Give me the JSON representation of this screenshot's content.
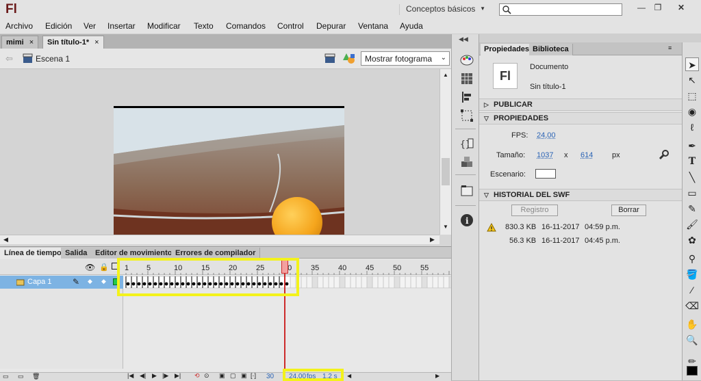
{
  "app": {
    "logo": "Fl"
  },
  "workspace": {
    "label": "Conceptos básicos"
  },
  "menu": [
    "Archivo",
    "Edición",
    "Ver",
    "Insertar",
    "Modificar",
    "Texto",
    "Comandos",
    "Control",
    "Depurar",
    "Ventana",
    "Ayuda"
  ],
  "doc_tabs": [
    {
      "label": "mimi",
      "close": "×"
    },
    {
      "label": "Sin título-1*",
      "close": "×"
    }
  ],
  "edit_bar": {
    "scene": "Escena 1",
    "view_select": "Mostrar fotograma"
  },
  "timeline": {
    "tabs": [
      "Línea de tiempo",
      "Salida",
      "Editor de movimiento",
      "Errores de compilador"
    ],
    "ruler": [
      "1",
      "5",
      "10",
      "15",
      "20",
      "25",
      "30",
      "35",
      "40",
      "45",
      "50",
      "55"
    ],
    "layer_name": "Capa 1",
    "current_frame": "30",
    "fps": "24,00",
    "fps_unit": "fps",
    "elapsed": "1,2 s",
    "keyframe_count": 30
  },
  "properties": {
    "tabs": [
      "Propiedades",
      "Biblioteca"
    ],
    "doc_icon": "Fl",
    "doc_type": "Documento",
    "doc_name": "Sin título-1",
    "sections": {
      "publish": "PUBLICAR",
      "props": "PROPIEDADES",
      "history": "HISTORIAL DEL SWF"
    },
    "fps_label": "FPS:",
    "fps_value": "24,00",
    "size_label": "Tamaño:",
    "width": "1037",
    "x": "x",
    "height": "614",
    "unit": "px",
    "stage_label": "Escenario:",
    "stage_color": "#ffffff",
    "btn_log": "Registro",
    "btn_clear": "Borrar",
    "history": [
      {
        "size": "830.3 KB",
        "date": "16-11-2017",
        "time": "04:59 p.m.",
        "warning": true
      },
      {
        "size": "56.3 KB",
        "date": "16-11-2017",
        "time": "04:45 p.m.",
        "warning": false
      }
    ]
  },
  "colors": {
    "highlight": "#f3f21b",
    "playhead": "#cc2a2a",
    "layer_row": "#7db3e3"
  }
}
